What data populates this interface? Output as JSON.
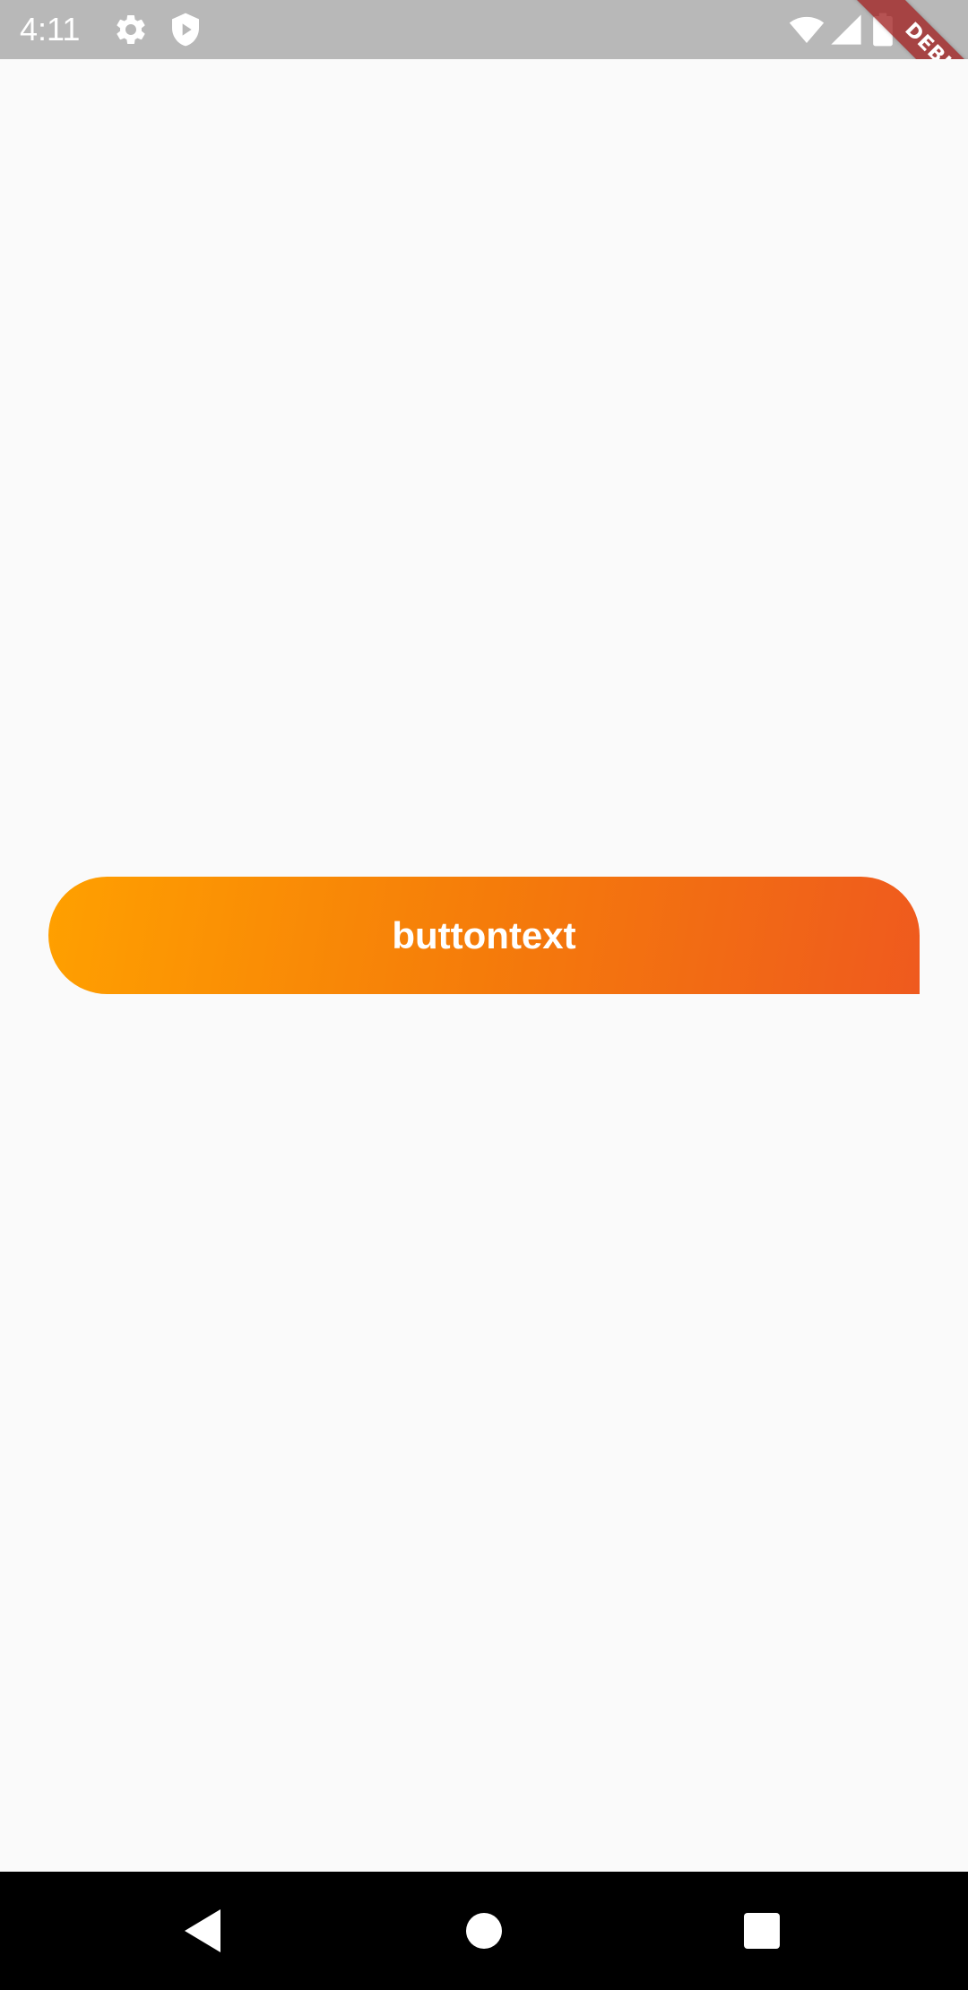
{
  "status_bar": {
    "time": "4:11",
    "icons": [
      "settings-gear-icon",
      "shield-play-icon",
      "wifi-icon",
      "cell-signal-icon",
      "battery-icon"
    ],
    "background_color": "#b8b8b8"
  },
  "debug_banner": {
    "label": "DEBUG",
    "color": "#a12222"
  },
  "main": {
    "button": {
      "label": "buttontext",
      "gradient_start": "#ffa000",
      "gradient_end": "#ef5a1e"
    }
  },
  "nav_bar": {
    "icons": [
      "back-triangle-icon",
      "home-circle-icon",
      "recents-square-icon"
    ]
  }
}
